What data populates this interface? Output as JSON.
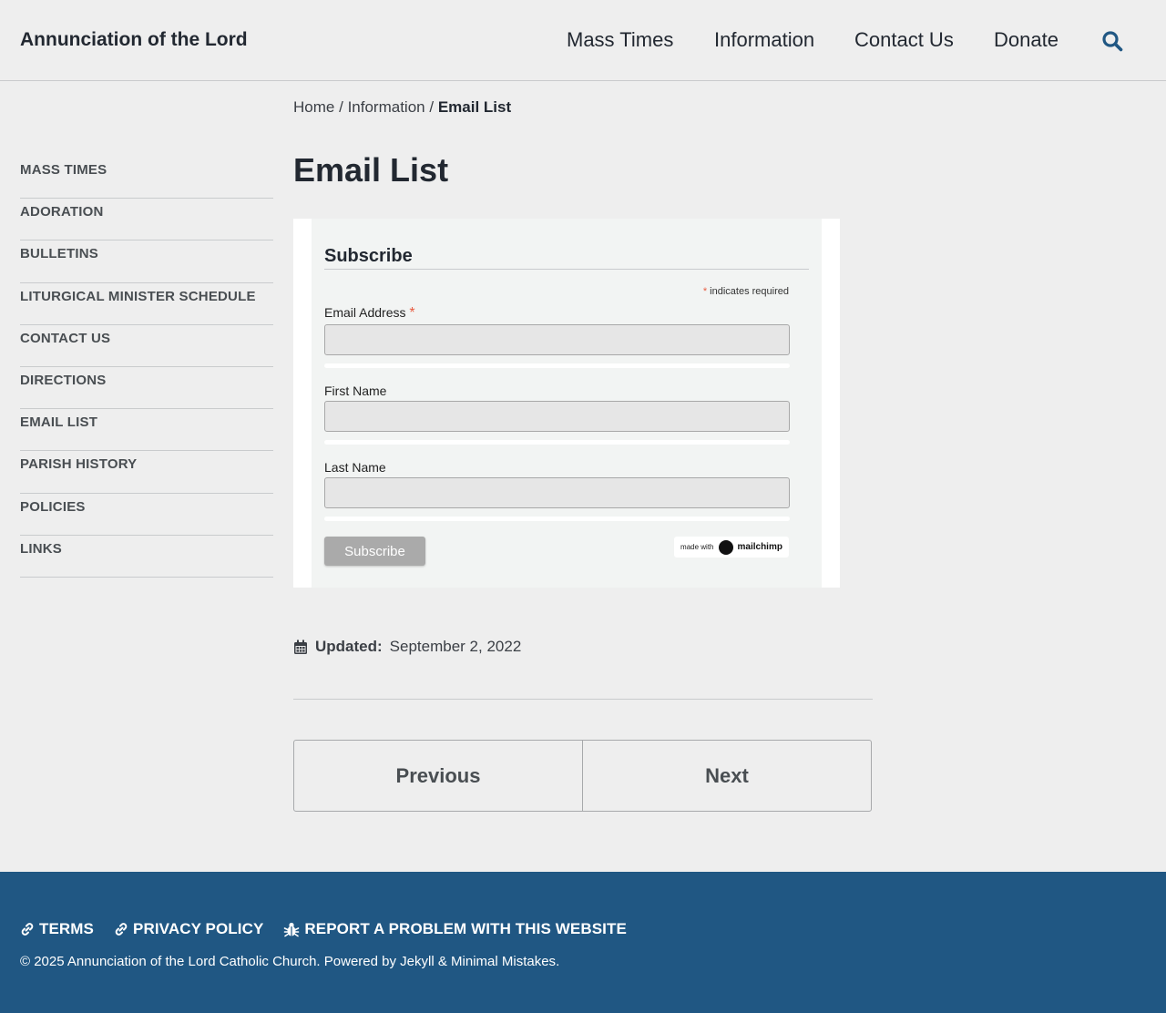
{
  "header": {
    "site_title": "Annunciation of the Lord",
    "nav": [
      "Mass Times",
      "Information",
      "Contact Us",
      "Donate"
    ],
    "search_icon": "search-icon",
    "accent_color": "#205783"
  },
  "breadcrumb": {
    "home": "Home",
    "separator": "/",
    "section": "Information",
    "current": "Email List"
  },
  "sidebar": {
    "items": [
      "MASS TIMES",
      "ADORATION",
      "BULLETINS",
      "LITURGICAL MINISTER SCHEDULE",
      "CONTACT US",
      "DIRECTIONS",
      "EMAIL LIST",
      "PARISH HISTORY",
      "POLICIES",
      "LINKS"
    ]
  },
  "page": {
    "title": "Email List"
  },
  "signup": {
    "heading": "Subscribe",
    "required_asterisk": "*",
    "required_note": "indicates required",
    "email_label": "Email Address",
    "email_value": "",
    "first_name_label": "First Name",
    "first_name_value": "",
    "last_name_label": "Last Name",
    "last_name_value": "",
    "subscribe_button": "Subscribe",
    "badge_small": "made with",
    "badge_brand": "mailchimp"
  },
  "meta": {
    "updated_label": "Updated:",
    "updated_date": "September 2, 2022",
    "calendar_icon": "calendar-icon"
  },
  "pager": {
    "previous": "Previous",
    "next": "Next"
  },
  "footer": {
    "links": [
      {
        "icon": "link-icon",
        "label": "TERMS"
      },
      {
        "icon": "link-icon",
        "label": "PRIVACY POLICY"
      },
      {
        "icon": "bug-icon",
        "label": "REPORT A PROBLEM WITH THIS WEBSITE"
      }
    ],
    "copyright_prefix": "© 2025 Annunciation of the Lord Catholic Church. Powered by",
    "jekyll": "Jekyll",
    "amp": "&",
    "minimal_mistakes": "Minimal Mistakes",
    "period": "."
  }
}
